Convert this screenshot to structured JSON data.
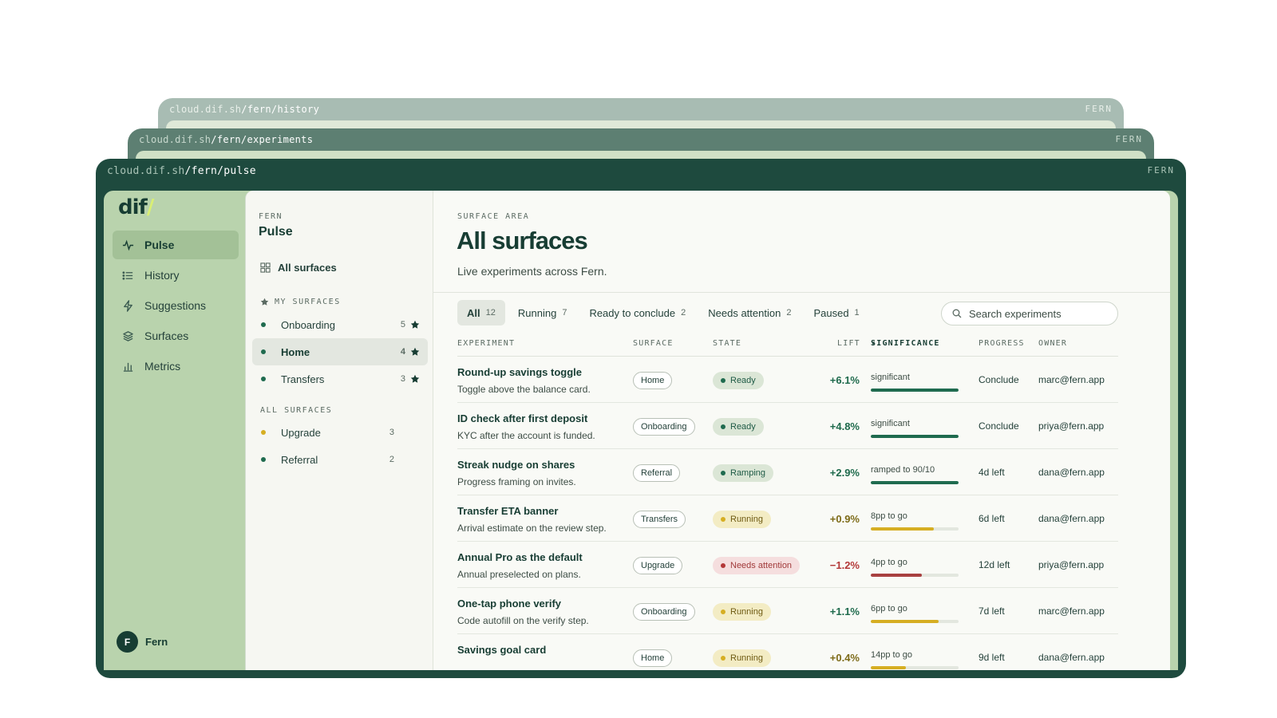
{
  "windows": [
    {
      "url_host": "cloud.dif.sh",
      "url_path": "/fern/history",
      "brand": "FERN"
    },
    {
      "url_host": "cloud.dif.sh",
      "url_path": "/fern/experiments",
      "brand": "FERN"
    },
    {
      "url_host": "cloud.dif.sh",
      "url_path": "/fern/pulse",
      "brand": "FERN"
    }
  ],
  "logo": {
    "text": "dif",
    "slash": "/"
  },
  "nav": [
    {
      "label": "Pulse",
      "icon": "pulse-icon",
      "active": true
    },
    {
      "label": "History",
      "icon": "list-icon"
    },
    {
      "label": "Suggestions",
      "icon": "lightning-icon"
    },
    {
      "label": "Surfaces",
      "icon": "layers-icon"
    },
    {
      "label": "Metrics",
      "icon": "bar-chart-icon"
    }
  ],
  "user": {
    "initial": "F",
    "name": "Fern"
  },
  "surface_panel": {
    "kicker": "FERN",
    "title": "Pulse",
    "all_label": "All surfaces",
    "my_heading": "MY SURFACES",
    "all_heading": "ALL SURFACES",
    "my_surfaces": [
      {
        "name": "Onboarding",
        "count": "5",
        "dot": "#1f6b4f"
      },
      {
        "name": "Home",
        "count": "4",
        "dot": "#1f6b4f"
      },
      {
        "name": "Transfers",
        "count": "3",
        "dot": "#1f6b4f"
      }
    ],
    "all_surfaces": [
      {
        "name": "Upgrade",
        "count": "3",
        "dot": "#d6ae22"
      },
      {
        "name": "Referral",
        "count": "2",
        "dot": "#1f6b4f"
      }
    ]
  },
  "main": {
    "kicker": "SURFACE AREA",
    "title": "All surfaces",
    "subtitle": "Live experiments across Fern.",
    "tabs": [
      {
        "label": "All",
        "count": "12"
      },
      {
        "label": "Running",
        "count": "7"
      },
      {
        "label": "Ready to conclude",
        "count": "2"
      },
      {
        "label": "Needs attention",
        "count": "2"
      },
      {
        "label": "Paused",
        "count": "1"
      }
    ],
    "search_placeholder": "Search experiments",
    "columns": {
      "experiment": "EXPERIMENT",
      "surface": "SURFACE",
      "state": "STATE",
      "lift": "LIFT",
      "significance": "SIGNIFICANCE",
      "progress": "PROGRESS",
      "owner": "OWNER"
    },
    "rows": [
      {
        "name": "Round-up savings toggle",
        "desc": "Toggle above the balance card.",
        "surface": "Home",
        "state": "Ready",
        "lift": "+6.1%",
        "sig": "significant",
        "sig_level": 1.0,
        "progress": "Conclude",
        "owner": "marc@fern.app"
      },
      {
        "name": "ID check after first deposit",
        "desc": "KYC after the account is funded.",
        "surface": "Onboarding",
        "state": "Ready",
        "lift": "+4.8%",
        "sig": "significant",
        "sig_level": 1.0,
        "progress": "Conclude",
        "owner": "priya@fern.app"
      },
      {
        "name": "Streak nudge on shares",
        "desc": "Progress framing on invites.",
        "surface": "Referral",
        "state": "Ramping",
        "lift": "+2.9%",
        "sig": "ramped to 90/10",
        "sig_level": 1.0,
        "progress": "4d left",
        "owner": "dana@fern.app"
      },
      {
        "name": "Transfer ETA banner",
        "desc": "Arrival estimate on the review step.",
        "surface": "Transfers",
        "state": "Running",
        "lift": "+0.9%",
        "sig": "8pp to go",
        "sig_level": 0.72,
        "progress": "6d left",
        "owner": "dana@fern.app"
      },
      {
        "name": "Annual Pro as the default",
        "desc": "Annual preselected on plans.",
        "surface": "Upgrade",
        "state": "Needs attention",
        "lift": "−1.2%",
        "sig": "4pp to go",
        "sig_level": 0.58,
        "progress": "12d left",
        "owner": "priya@fern.app"
      },
      {
        "name": "One-tap phone verify",
        "desc": "Code autofill on the verify step.",
        "surface": "Onboarding",
        "state": "Running",
        "lift": "+1.1%",
        "sig": "6pp to go",
        "sig_level": 0.77,
        "progress": "7d left",
        "owner": "marc@fern.app"
      },
      {
        "name": "Savings goal card",
        "desc": "",
        "surface": "Home",
        "state": "Running",
        "lift": "+0.4%",
        "sig": "14pp to go",
        "sig_level": 0.4,
        "progress": "9d left",
        "owner": "dana@fern.app"
      }
    ]
  },
  "colors": {
    "brand_dark": "#1e4a3e",
    "rail": "#b9d3ad",
    "ready": "#1f6b4f",
    "running": "#d6ae22",
    "attention": "#b33838"
  }
}
